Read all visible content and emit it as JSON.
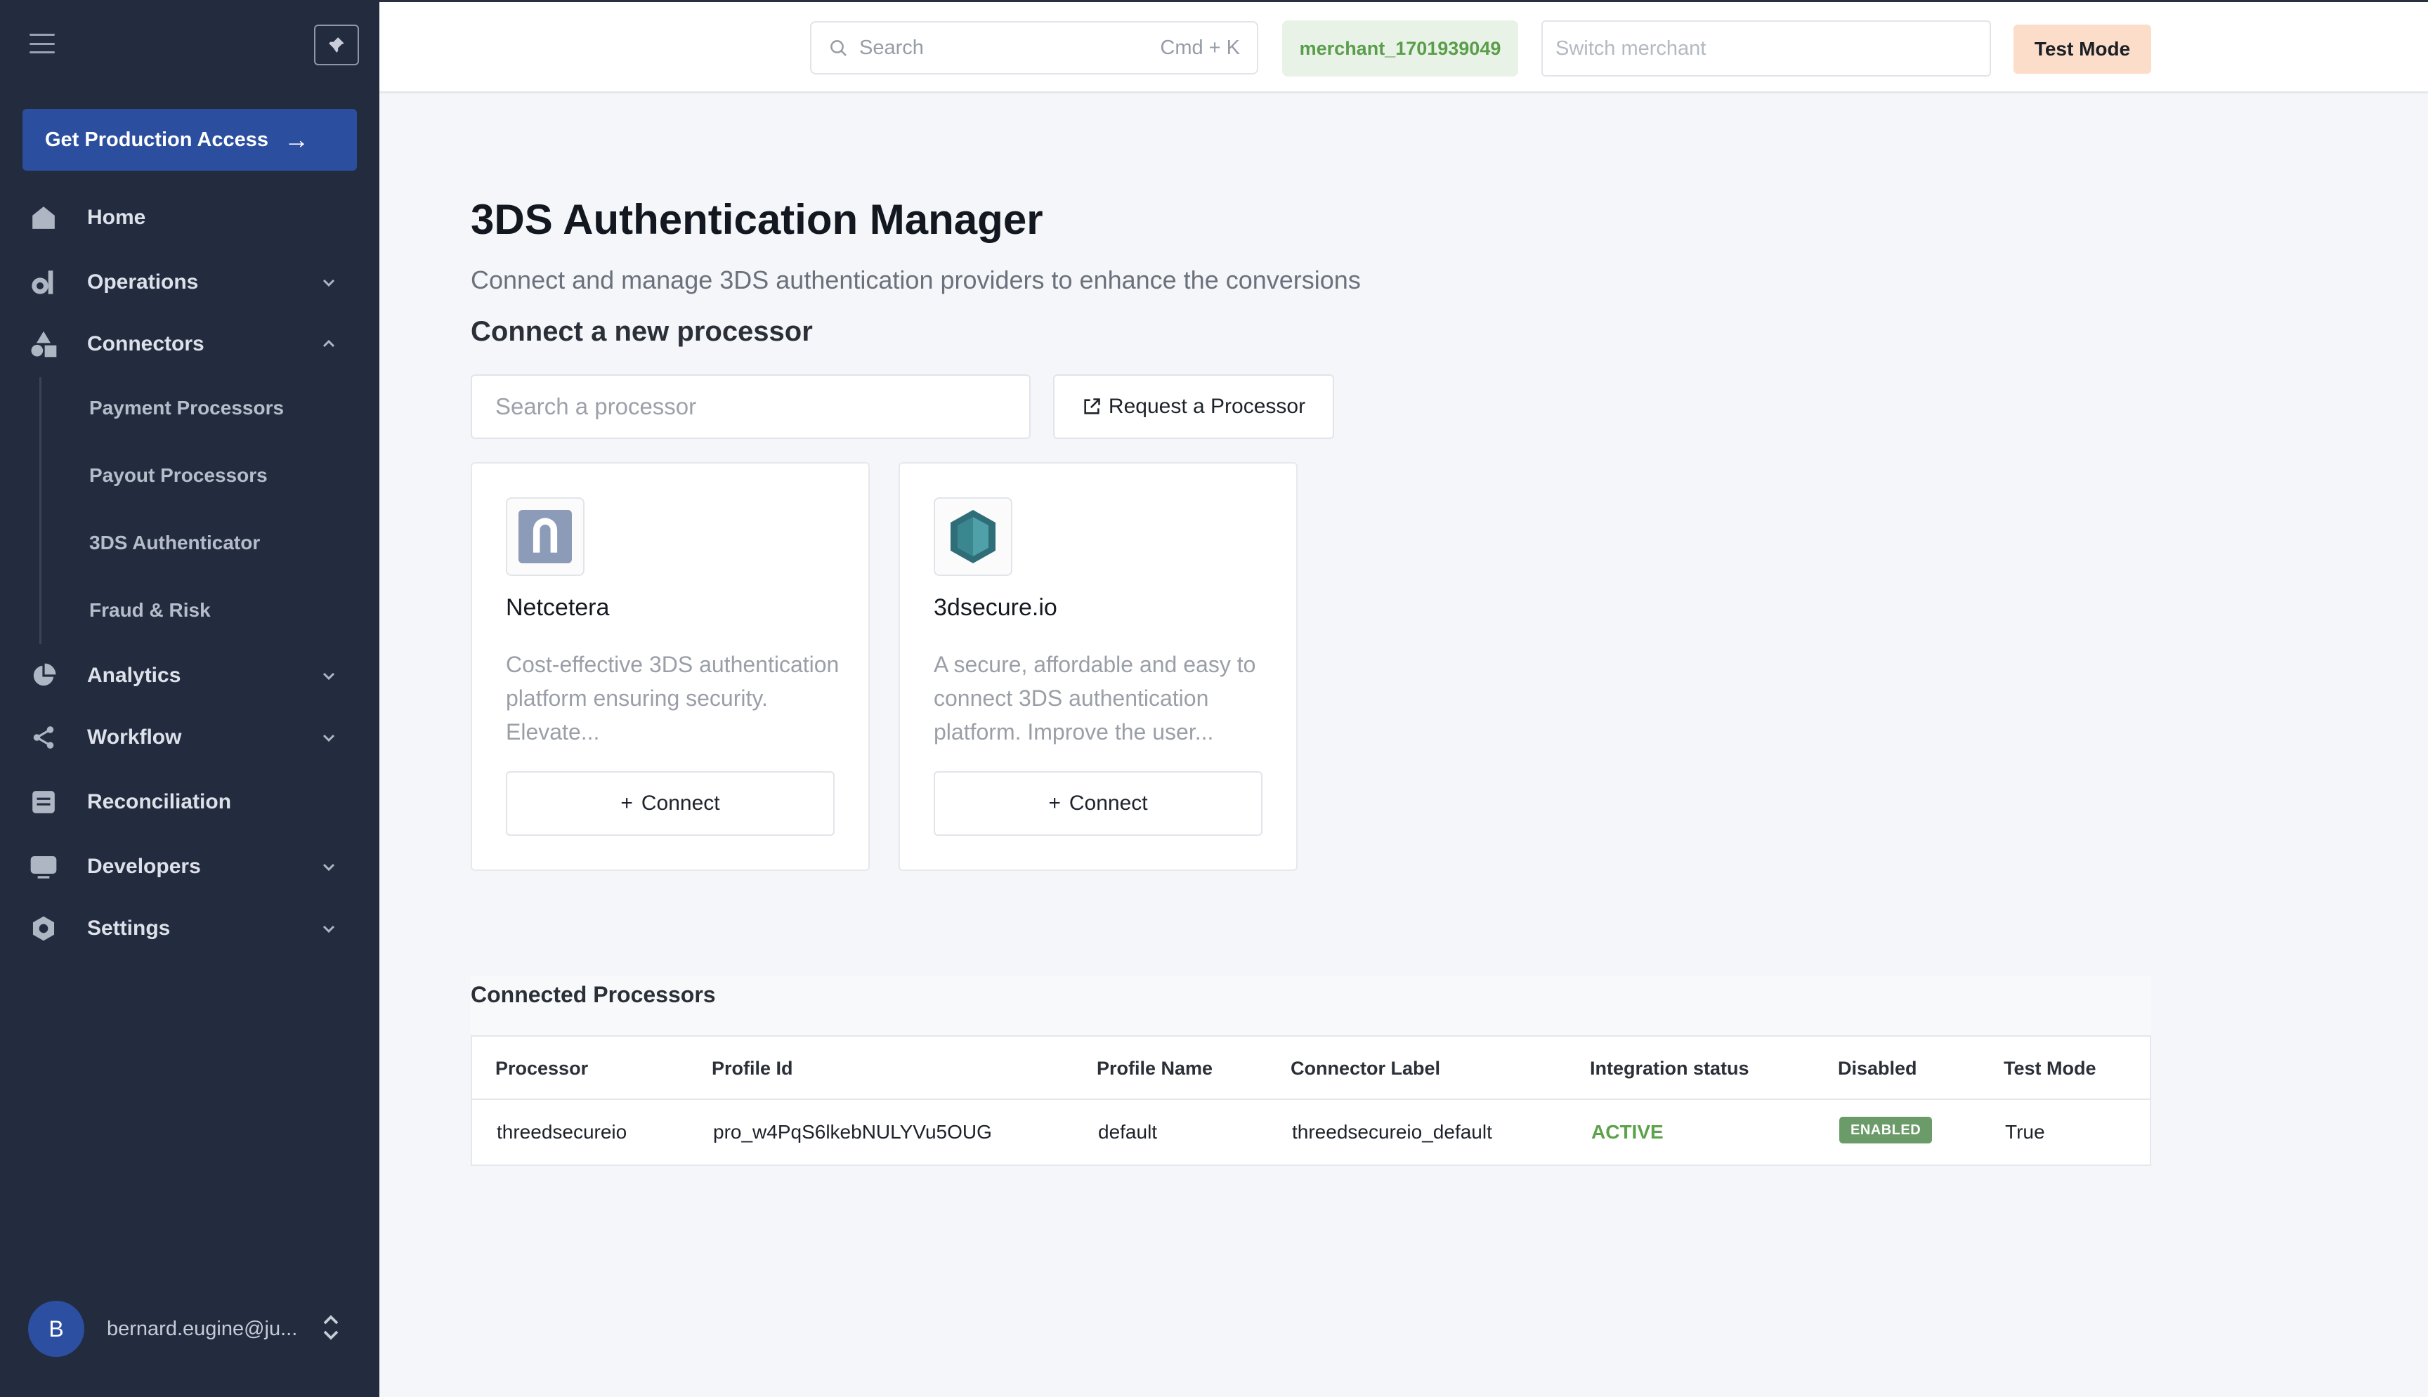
{
  "sidebar": {
    "production_button": "Get Production Access",
    "nav": {
      "home": "Home",
      "operations": "Operations",
      "connectors": "Connectors",
      "analytics": "Analytics",
      "workflow": "Workflow",
      "reconciliation": "Reconciliation",
      "developers": "Developers",
      "settings": "Settings"
    },
    "connectors_sub": {
      "payment": "Payment Processors",
      "payout": "Payout Processors",
      "three_ds": "3DS Authenticator",
      "fraud": "Fraud & Risk"
    },
    "user": {
      "initial": "B",
      "email": "bernard.eugine@ju..."
    }
  },
  "topbar": {
    "search_placeholder": "Search",
    "search_shortcut": "Cmd + K",
    "merchant_id": "merchant_1701939049",
    "switch_placeholder": "Switch merchant",
    "test_mode": "Test Mode"
  },
  "main": {
    "title": "3DS Authentication Manager",
    "subtitle": "Connect and manage 3DS authentication providers to enhance the conversions",
    "connect_heading": "Connect a new processor",
    "processor_search_placeholder": "Search a processor",
    "request_button": "Request a Processor",
    "cards": [
      {
        "name": "Netcetera",
        "description": "Cost-effective 3DS authentication platform ensuring security. Elevate...",
        "button": "Connect",
        "logo": "netcetera-logo"
      },
      {
        "name": "3dsecure.io",
        "description": "A secure, affordable and easy to connect 3DS authentication platform. Improve the user...",
        "button": "Connect",
        "logo": "3dsecure-logo"
      }
    ],
    "connected": {
      "title": "Connected Processors",
      "columns": [
        "Processor",
        "Profile Id",
        "Profile Name",
        "Connector Label",
        "Integration status",
        "Disabled",
        "Test Mode"
      ],
      "rows": [
        {
          "processor": "threedsecureio",
          "profile_id": "pro_w4PqS6lkebNULYVu5OUG",
          "profile_name": "default",
          "connector_label": "threedsecureio_default",
          "integration_status": "ACTIVE",
          "disabled": "ENABLED",
          "test_mode": "True"
        }
      ]
    }
  },
  "colors": {
    "sidebar_bg": "#232b3e",
    "primary": "#2b4e9f",
    "merchant_green": "#5a9e4b",
    "test_mode_bg": "#fbddc9",
    "status_active": "#5ca24a",
    "badge_enabled": "#6b9b68"
  }
}
